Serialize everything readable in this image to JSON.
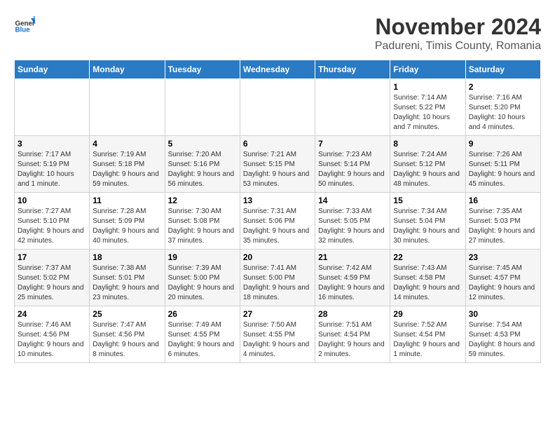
{
  "header": {
    "logo_general": "General",
    "logo_blue": "Blue",
    "month_title": "November 2024",
    "subtitle": "Padureni, Timis County, Romania"
  },
  "weekdays": [
    "Sunday",
    "Monday",
    "Tuesday",
    "Wednesday",
    "Thursday",
    "Friday",
    "Saturday"
  ],
  "weeks": [
    [
      {
        "day": "",
        "info": ""
      },
      {
        "day": "",
        "info": ""
      },
      {
        "day": "",
        "info": ""
      },
      {
        "day": "",
        "info": ""
      },
      {
        "day": "",
        "info": ""
      },
      {
        "day": "1",
        "info": "Sunrise: 7:14 AM\nSunset: 5:22 PM\nDaylight: 10 hours and 7 minutes."
      },
      {
        "day": "2",
        "info": "Sunrise: 7:16 AM\nSunset: 5:20 PM\nDaylight: 10 hours and 4 minutes."
      }
    ],
    [
      {
        "day": "3",
        "info": "Sunrise: 7:17 AM\nSunset: 5:19 PM\nDaylight: 10 hours and 1 minute."
      },
      {
        "day": "4",
        "info": "Sunrise: 7:19 AM\nSunset: 5:18 PM\nDaylight: 9 hours and 59 minutes."
      },
      {
        "day": "5",
        "info": "Sunrise: 7:20 AM\nSunset: 5:16 PM\nDaylight: 9 hours and 56 minutes."
      },
      {
        "day": "6",
        "info": "Sunrise: 7:21 AM\nSunset: 5:15 PM\nDaylight: 9 hours and 53 minutes."
      },
      {
        "day": "7",
        "info": "Sunrise: 7:23 AM\nSunset: 5:14 PM\nDaylight: 9 hours and 50 minutes."
      },
      {
        "day": "8",
        "info": "Sunrise: 7:24 AM\nSunset: 5:12 PM\nDaylight: 9 hours and 48 minutes."
      },
      {
        "day": "9",
        "info": "Sunrise: 7:26 AM\nSunset: 5:11 PM\nDaylight: 9 hours and 45 minutes."
      }
    ],
    [
      {
        "day": "10",
        "info": "Sunrise: 7:27 AM\nSunset: 5:10 PM\nDaylight: 9 hours and 42 minutes."
      },
      {
        "day": "11",
        "info": "Sunrise: 7:28 AM\nSunset: 5:09 PM\nDaylight: 9 hours and 40 minutes."
      },
      {
        "day": "12",
        "info": "Sunrise: 7:30 AM\nSunset: 5:08 PM\nDaylight: 9 hours and 37 minutes."
      },
      {
        "day": "13",
        "info": "Sunrise: 7:31 AM\nSunset: 5:06 PM\nDaylight: 9 hours and 35 minutes."
      },
      {
        "day": "14",
        "info": "Sunrise: 7:33 AM\nSunset: 5:05 PM\nDaylight: 9 hours and 32 minutes."
      },
      {
        "day": "15",
        "info": "Sunrise: 7:34 AM\nSunset: 5:04 PM\nDaylight: 9 hours and 30 minutes."
      },
      {
        "day": "16",
        "info": "Sunrise: 7:35 AM\nSunset: 5:03 PM\nDaylight: 9 hours and 27 minutes."
      }
    ],
    [
      {
        "day": "17",
        "info": "Sunrise: 7:37 AM\nSunset: 5:02 PM\nDaylight: 9 hours and 25 minutes."
      },
      {
        "day": "18",
        "info": "Sunrise: 7:38 AM\nSunset: 5:01 PM\nDaylight: 9 hours and 23 minutes."
      },
      {
        "day": "19",
        "info": "Sunrise: 7:39 AM\nSunset: 5:00 PM\nDaylight: 9 hours and 20 minutes."
      },
      {
        "day": "20",
        "info": "Sunrise: 7:41 AM\nSunset: 5:00 PM\nDaylight: 9 hours and 18 minutes."
      },
      {
        "day": "21",
        "info": "Sunrise: 7:42 AM\nSunset: 4:59 PM\nDaylight: 9 hours and 16 minutes."
      },
      {
        "day": "22",
        "info": "Sunrise: 7:43 AM\nSunset: 4:58 PM\nDaylight: 9 hours and 14 minutes."
      },
      {
        "day": "23",
        "info": "Sunrise: 7:45 AM\nSunset: 4:57 PM\nDaylight: 9 hours and 12 minutes."
      }
    ],
    [
      {
        "day": "24",
        "info": "Sunrise: 7:46 AM\nSunset: 4:56 PM\nDaylight: 9 hours and 10 minutes."
      },
      {
        "day": "25",
        "info": "Sunrise: 7:47 AM\nSunset: 4:56 PM\nDaylight: 9 hours and 8 minutes."
      },
      {
        "day": "26",
        "info": "Sunrise: 7:49 AM\nSunset: 4:55 PM\nDaylight: 9 hours and 6 minutes."
      },
      {
        "day": "27",
        "info": "Sunrise: 7:50 AM\nSunset: 4:55 PM\nDaylight: 9 hours and 4 minutes."
      },
      {
        "day": "28",
        "info": "Sunrise: 7:51 AM\nSunset: 4:54 PM\nDaylight: 9 hours and 2 minutes."
      },
      {
        "day": "29",
        "info": "Sunrise: 7:52 AM\nSunset: 4:54 PM\nDaylight: 9 hours and 1 minute."
      },
      {
        "day": "30",
        "info": "Sunrise: 7:54 AM\nSunset: 4:53 PM\nDaylight: 8 hours and 59 minutes."
      }
    ]
  ]
}
